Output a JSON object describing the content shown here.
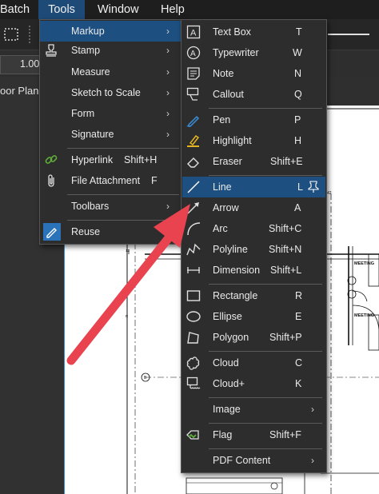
{
  "menubar": {
    "items": [
      {
        "label": "Batch"
      },
      {
        "label": "Tools"
      },
      {
        "label": "Window"
      },
      {
        "label": "Help"
      }
    ]
  },
  "toolbar": {
    "zoom_value": "1.00"
  },
  "left_panel": {
    "tab_label": "oor Plan"
  },
  "tools_menu": {
    "items": [
      {
        "label": "Markup",
        "icon": "blank",
        "submenu": true
      },
      {
        "label": "Stamp",
        "icon": "stamp-icon",
        "submenu": true
      },
      {
        "label": "Measure",
        "icon": "blank",
        "submenu": true
      },
      {
        "label": "Sketch to Scale",
        "icon": "blank",
        "submenu": true
      },
      {
        "label": "Form",
        "icon": "blank",
        "submenu": true
      },
      {
        "label": "Signature",
        "icon": "blank",
        "submenu": true
      },
      {
        "label": "Hyperlink",
        "shortcut": "Shift+H",
        "icon": "chain-link-icon"
      },
      {
        "label": "File Attachment",
        "shortcut": "F",
        "icon": "paperclip-icon"
      },
      {
        "label": "Toolbars",
        "icon": "blank",
        "submenu": true
      },
      {
        "label": "Reuse",
        "icon": "reuse-icon"
      }
    ]
  },
  "markup_menu": {
    "items": [
      {
        "label": "Text Box",
        "shortcut": "T",
        "icon": "text-box-icon"
      },
      {
        "label": "Typewriter",
        "shortcut": "W",
        "icon": "typewriter-icon"
      },
      {
        "label": "Note",
        "shortcut": "N",
        "icon": "note-icon"
      },
      {
        "label": "Callout",
        "shortcut": "Q",
        "icon": "callout-icon"
      },
      {
        "label": "Pen",
        "shortcut": "P",
        "icon": "pen-icon"
      },
      {
        "label": "Highlight",
        "shortcut": "H",
        "icon": "highlight-icon"
      },
      {
        "label": "Eraser",
        "shortcut": "Shift+E",
        "icon": "eraser-icon"
      },
      {
        "label": "Line",
        "shortcut": "L",
        "icon": "line-icon",
        "pinned": true
      },
      {
        "label": "Arrow",
        "shortcut": "A",
        "icon": "arrow-icon"
      },
      {
        "label": "Arc",
        "shortcut": "Shift+C",
        "icon": "arc-icon"
      },
      {
        "label": "Polyline",
        "shortcut": "Shift+N",
        "icon": "polyline-icon"
      },
      {
        "label": "Dimension",
        "shortcut": "Shift+L",
        "icon": "dimension-icon"
      },
      {
        "label": "Rectangle",
        "shortcut": "R",
        "icon": "rectangle-icon"
      },
      {
        "label": "Ellipse",
        "shortcut": "E",
        "icon": "ellipse-icon"
      },
      {
        "label": "Polygon",
        "shortcut": "Shift+P",
        "icon": "polygon-icon"
      },
      {
        "label": "Cloud",
        "shortcut": "C",
        "icon": "cloud-icon"
      },
      {
        "label": "Cloud+",
        "shortcut": "K",
        "icon": "cloud-plus-icon"
      },
      {
        "label": "Image",
        "icon": "blank",
        "submenu": true
      },
      {
        "label": "Flag",
        "shortcut": "Shift+F",
        "icon": "flag-icon"
      },
      {
        "label": "PDF Content",
        "icon": "blank",
        "submenu": true
      }
    ]
  },
  "drawing": {
    "labels": [
      "MEETING",
      "MEETING"
    ],
    "grid_tags": [
      "42",
      "12"
    ],
    "bubbles": [
      "B",
      "R"
    ]
  },
  "colors": {
    "highlight": "#1d4f80",
    "annotation_arrow": "#e8434f",
    "menu_bg": "#2d2d2d"
  }
}
